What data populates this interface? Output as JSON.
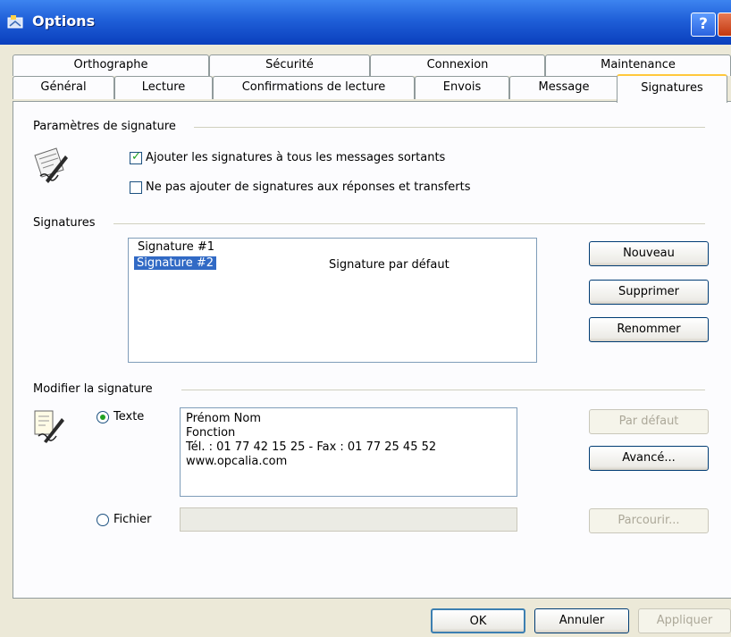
{
  "window": {
    "title": "Options"
  },
  "tabs_row1": [
    {
      "label": "Orthographe"
    },
    {
      "label": "Sécurité"
    },
    {
      "label": "Connexion"
    },
    {
      "label": "Maintenance"
    }
  ],
  "tabs_row2": [
    {
      "label": "Général"
    },
    {
      "label": "Lecture"
    },
    {
      "label": "Confirmations de lecture"
    },
    {
      "label": "Envois"
    },
    {
      "label": "Message"
    },
    {
      "label": "Signatures",
      "active": true
    }
  ],
  "signature_settings": {
    "group_label": "Paramètres de signature",
    "add_to_all_label": "Ajouter les signatures à tous les messages sortants",
    "add_to_all_checked": true,
    "no_replies_label": "Ne pas ajouter de signatures aux réponses et transferts",
    "no_replies_checked": false
  },
  "signatures": {
    "group_label": "Signatures",
    "items": [
      {
        "name": "Signature #1",
        "note": ""
      },
      {
        "name": "Signature #2",
        "note": "Signature par défaut",
        "selected": true
      }
    ],
    "new_label": "Nouveau",
    "delete_label": "Supprimer",
    "rename_label": "Renommer"
  },
  "edit_signature": {
    "group_label": "Modifier la signature",
    "text_radio_label": "Texte",
    "text_selected": true,
    "text_lines": [
      "Prénom Nom",
      "Fonction",
      "Tél. : 01 77 42 15 25 - Fax : 01 77 25 45 52",
      "www.opcalia.com"
    ],
    "default_label": "Par défaut",
    "advanced_label": "Avancé...",
    "file_radio_label": "Fichier",
    "file_value": "",
    "browse_label": "Parcourir..."
  },
  "footer": {
    "ok_label": "OK",
    "cancel_label": "Annuler",
    "apply_label": "Appliquer"
  }
}
